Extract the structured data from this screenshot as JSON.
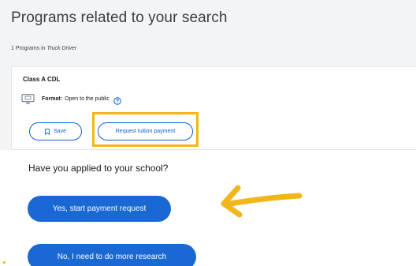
{
  "header": {
    "title": "Programs related to your search",
    "count_prefix": "1 Programs in",
    "search_term": "Truck Driver"
  },
  "program": {
    "title": "Class A CDL",
    "format_label": "Format:",
    "format_value": "Open to the public",
    "icons": {
      "format": "monitor-icon",
      "help": "help-icon",
      "save": "bookmark-icon"
    },
    "save_label": "Save",
    "request_label": "Request tuition payment"
  },
  "prompt": {
    "question": "Have you applied to your school?",
    "yes_label": "Yes, start payment request",
    "no_label": "No, I need to do more research"
  },
  "colors": {
    "primary": "#1a68d3",
    "link": "#0e5fd8",
    "highlight": "#f3b61a",
    "top_background": "#f3f4f5"
  }
}
